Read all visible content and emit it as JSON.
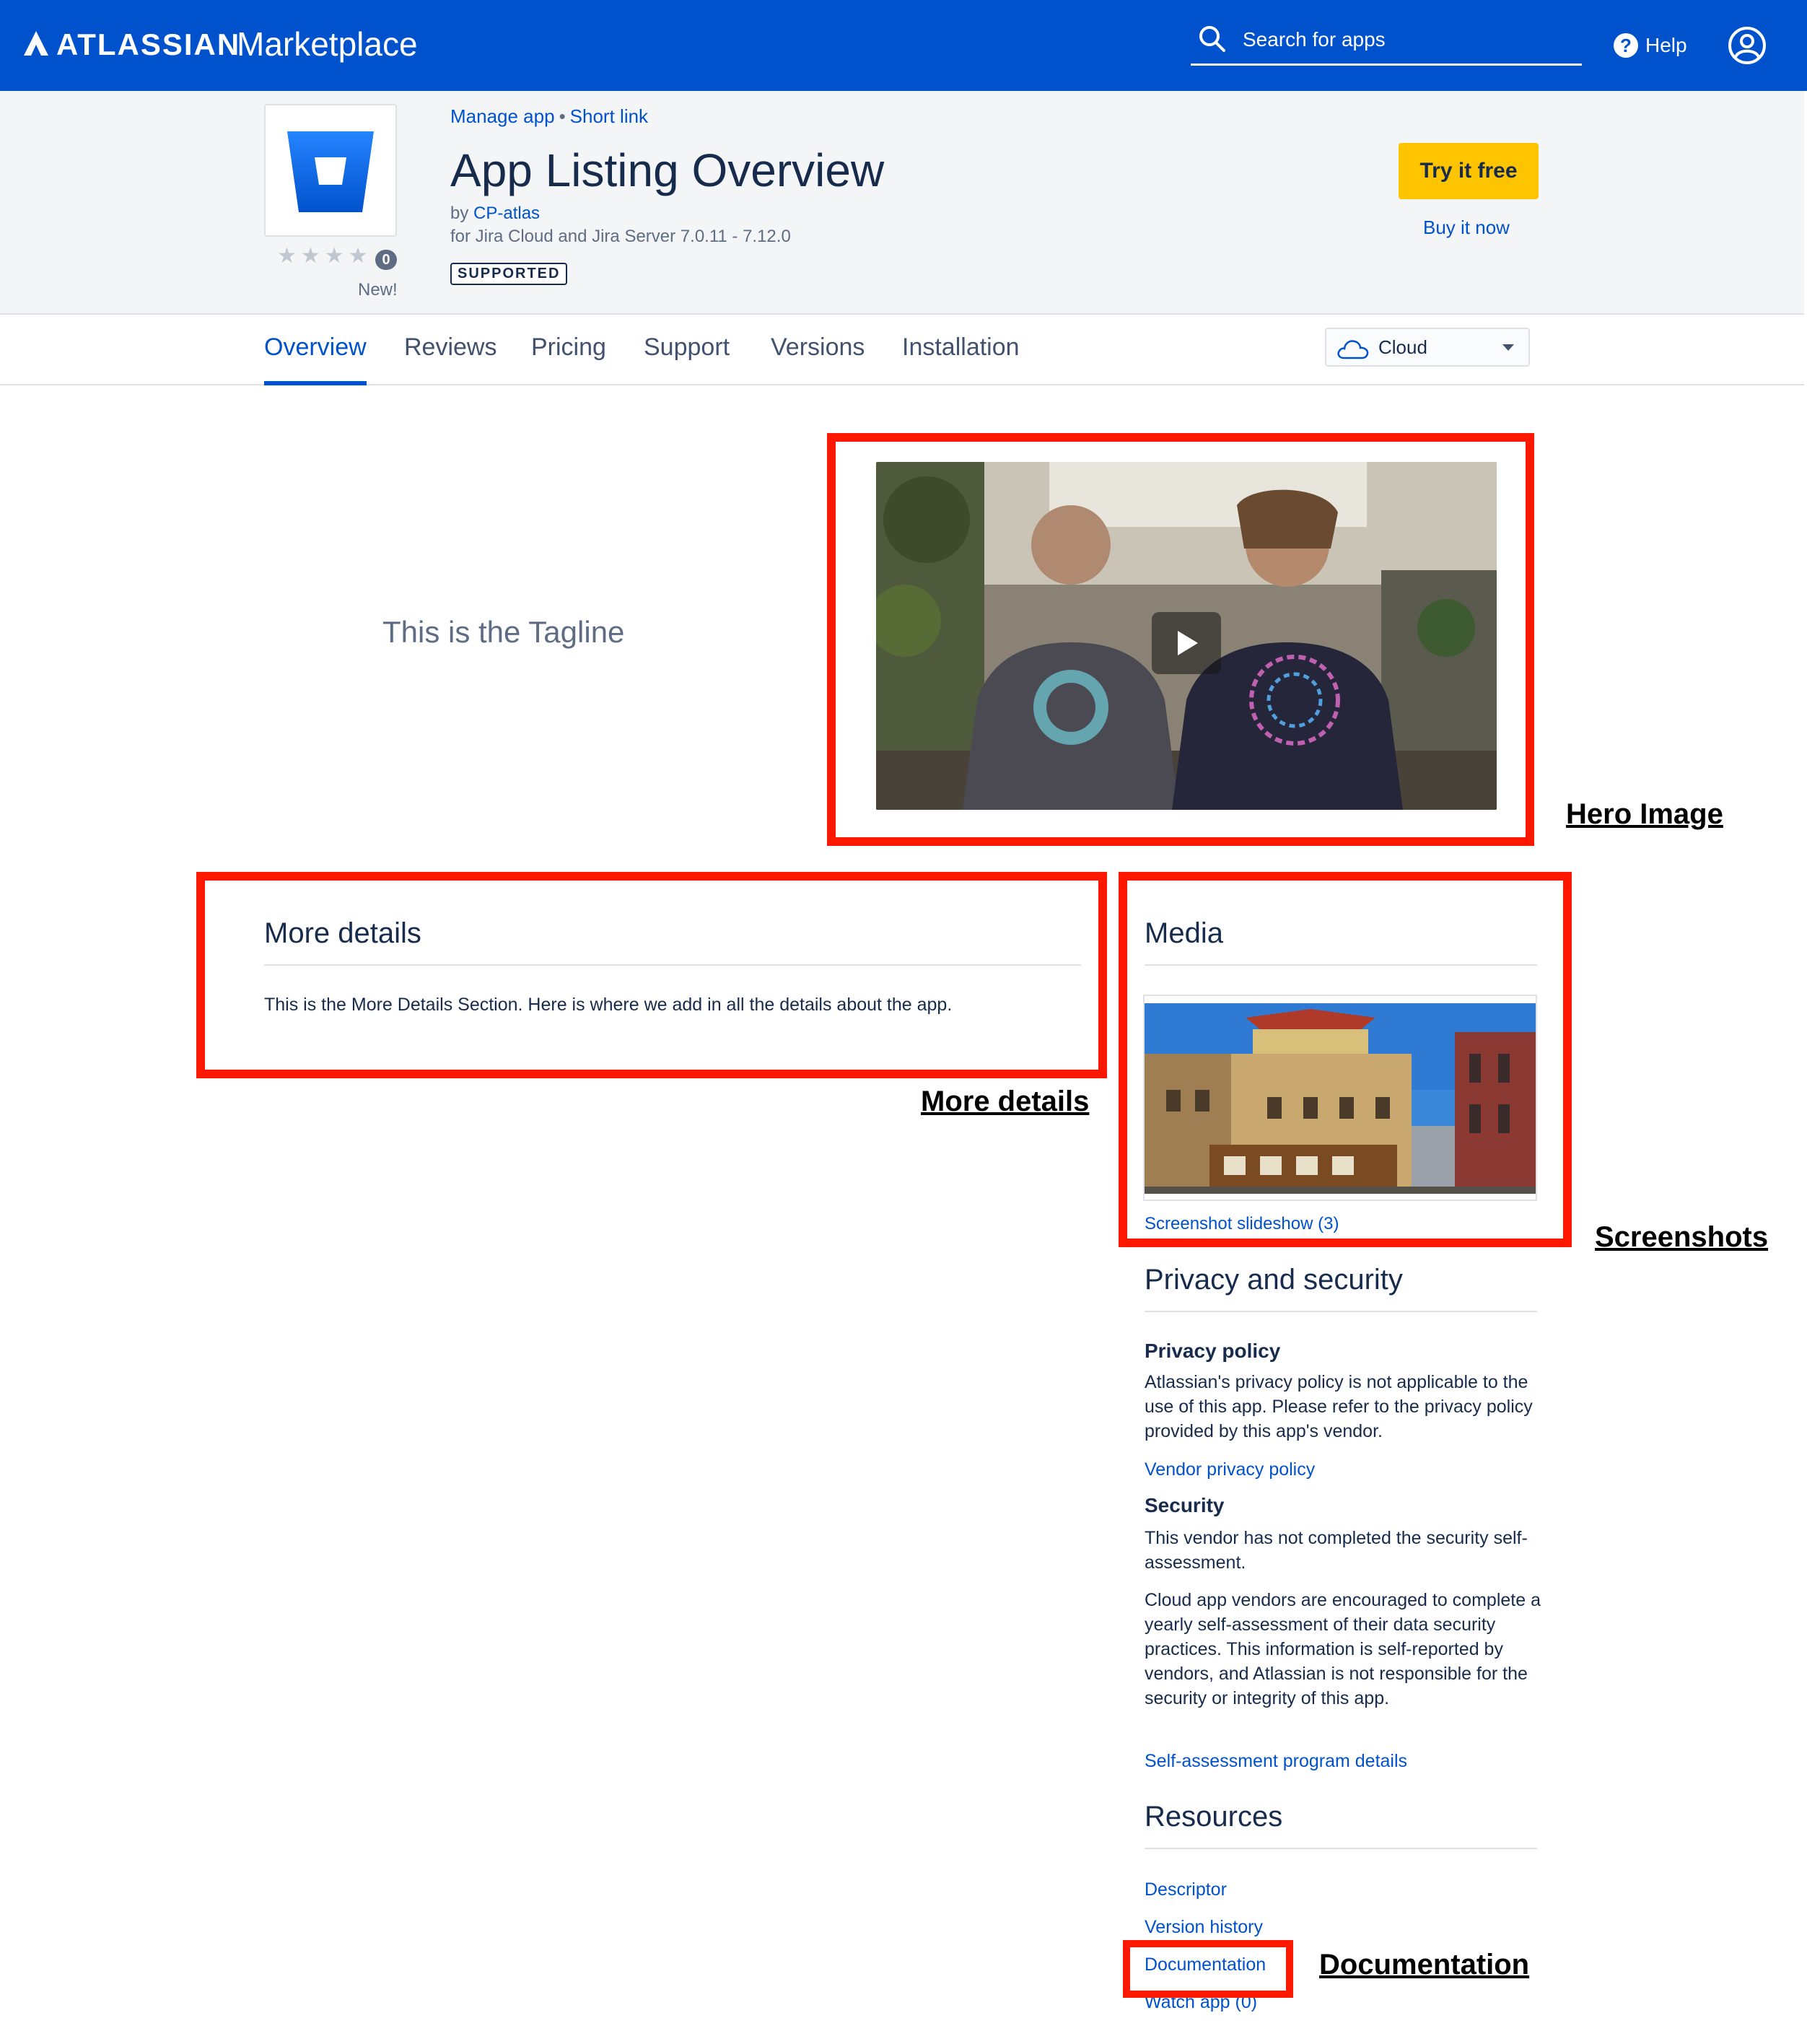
{
  "topbar": {
    "brand_name": "ATLASSIAN",
    "brand_product": "Marketplace",
    "search_placeholder": "Search for apps",
    "help_label": "Help"
  },
  "app": {
    "manage_label": "Manage app",
    "short_link_label": "Short link",
    "title": "App Listing Overview",
    "by_label": "by",
    "vendor": "CP-atlas",
    "compatibility": "for Jira Cloud and Jira Server 7.0.11 - 7.12.0",
    "badge": "SUPPORTED",
    "rating_count": "0",
    "rating_stars": 0,
    "new_label": "New!",
    "try_label": "Try it free",
    "buy_label": "Buy it now"
  },
  "tabs": [
    "Overview",
    "Reviews",
    "Pricing",
    "Support",
    "Versions",
    "Installation"
  ],
  "active_tab": "Overview",
  "hosting": {
    "selected": "Cloud"
  },
  "tagline": "This is the Tagline",
  "annotations": {
    "hero": "Hero Image",
    "details": "More details",
    "screenshots": "Screenshots",
    "documentation": "Documentation"
  },
  "details": {
    "heading": "More details",
    "text": "This is the More Details Section. Here is where we add in all the details about the app."
  },
  "media": {
    "heading": "Media",
    "slideshow_label": "Screenshot slideshow (3)"
  },
  "privacy": {
    "heading": "Privacy and security",
    "policy_heading": "Privacy policy",
    "policy_text": "Atlassian's privacy policy is not applicable to the use of this app. Please refer to the privacy policy provided by this app's vendor.",
    "vendor_policy_link": "Vendor privacy policy",
    "security_heading": "Security",
    "security_text": "This vendor has not completed the security self-assessment.",
    "security_text2": "Cloud app vendors are encouraged to complete a yearly self-assessment of their data security practices. This information is self-reported by vendors, and Atlassian is not responsible for the security or integrity of this app.",
    "self_assessment_link": "Self-assessment program details"
  },
  "resources": {
    "heading": "Resources",
    "links": [
      "Descriptor",
      "Version history",
      "Documentation",
      "Watch app (0)"
    ]
  },
  "colors": {
    "brand_blue": "#0052cc",
    "cta_yellow": "#ffc400",
    "annotation_red": "#ff1800",
    "text_dark": "#172b4d"
  },
  "icons": {
    "brand": "atlassian-logo-icon",
    "search": "search-icon",
    "help": "help-icon",
    "profile": "profile-icon",
    "app": "bitbucket-bucket-icon",
    "hosting": "cloud-icon",
    "play": "play-icon"
  }
}
